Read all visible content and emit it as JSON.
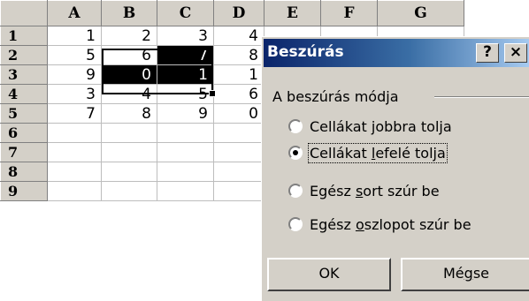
{
  "sheet": {
    "columns": [
      "A",
      "B",
      "C",
      "D",
      "E",
      "F",
      "G"
    ],
    "rows": [
      {
        "label": "1",
        "cells": [
          "1",
          "2",
          "3",
          "4",
          "",
          "",
          ""
        ]
      },
      {
        "label": "2",
        "cells": [
          "5",
          "6",
          "7",
          "8",
          "",
          "",
          ""
        ]
      },
      {
        "label": "3",
        "cells": [
          "9",
          "0",
          "1",
          "1",
          "",
          "",
          ""
        ]
      },
      {
        "label": "4",
        "cells": [
          "3",
          "4",
          "5",
          "6",
          "",
          "",
          ""
        ]
      },
      {
        "label": "5",
        "cells": [
          "7",
          "8",
          "9",
          "0",
          "",
          "",
          ""
        ]
      },
      {
        "label": "6",
        "cells": [
          "",
          "",
          "",
          "",
          "",
          "",
          ""
        ]
      },
      {
        "label": "7",
        "cells": [
          "",
          "",
          "",
          "",
          "",
          "",
          ""
        ]
      },
      {
        "label": "8",
        "cells": [
          "",
          "",
          "",
          "",
          "",
          "",
          ""
        ]
      },
      {
        "label": "9",
        "cells": [
          "",
          "",
          "",
          "",
          "",
          "",
          ""
        ]
      }
    ],
    "selection": "B2:C3",
    "active_cell": "B2"
  },
  "dialog": {
    "title": "Beszúrás",
    "help_label": "?",
    "close_label": "×",
    "group_label": "A beszúrás módja",
    "options": [
      {
        "pre": "Cellákat ",
        "key": "j",
        "post": "obbra tolja",
        "selected": false
      },
      {
        "pre": "Cellákat ",
        "key": "l",
        "post": "efelé tolja",
        "selected": true
      },
      {
        "pre": "Egész ",
        "key": "s",
        "post": "ort szúr be",
        "selected": false
      },
      {
        "pre": "Egész ",
        "key": "o",
        "post": "szlopot szúr be",
        "selected": false
      }
    ],
    "ok_label": "OK",
    "cancel_pre": "Mé",
    "cancel_key": "g",
    "cancel_post": "se"
  }
}
